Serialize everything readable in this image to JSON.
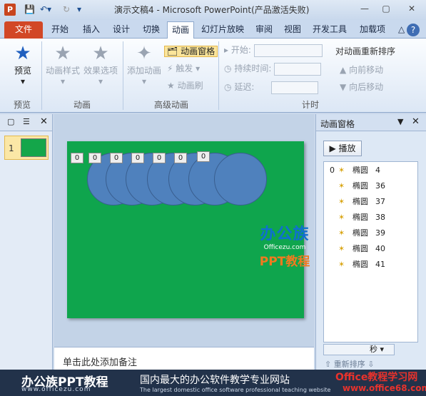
{
  "window": {
    "title": "演示文稿4 - Microsoft PowerPoint(产品激活失败)",
    "app_icon_letter": "P",
    "controls": [
      "—",
      "▢",
      "✕"
    ]
  },
  "tabs": {
    "file": "文件",
    "items": [
      "开始",
      "插入",
      "设计",
      "切换",
      "动画",
      "幻灯片放映",
      "审阅",
      "视图",
      "开发工具",
      "加载项"
    ],
    "active": "动画"
  },
  "ribbon": {
    "preview_btn": "预览",
    "preview_group": "预览",
    "anim_style": "动画样式",
    "effect_options": "效果选项",
    "anim_group": "动画",
    "add_anim": "添加动画",
    "anim_pane_btn": "动画窗格",
    "trigger": "触发 ▾",
    "anim_painter": "动画刷",
    "adv_group": "高级动画",
    "start_label": "开始:",
    "duration_label": "持续时间:",
    "delay_label": "延迟:",
    "reorder_title": "对动画重新排序",
    "move_earlier": "向前移动",
    "move_later": "向后移动",
    "timing_group": "计时"
  },
  "thumbnails": {
    "slide_number": "1"
  },
  "slide": {
    "tags": [
      "0",
      "0",
      "0",
      "0",
      "0",
      "0",
      "0"
    ],
    "watermark": {
      "brand": "办公族",
      "url": "Officezu.com",
      "sub": "PPT教程"
    }
  },
  "notes": {
    "placeholder": "单击此处添加备注"
  },
  "anim_pane": {
    "title": "动画窗格",
    "play_label": "播放",
    "items": [
      {
        "index": "0",
        "name": "椭圆",
        "num": "4"
      },
      {
        "index": "",
        "name": "椭圆",
        "num": "36"
      },
      {
        "index": "",
        "name": "椭圆",
        "num": "37"
      },
      {
        "index": "",
        "name": "椭圆",
        "num": "38"
      },
      {
        "index": "",
        "name": "椭圆",
        "num": "39"
      },
      {
        "index": "",
        "name": "椭圆",
        "num": "40"
      },
      {
        "index": "",
        "name": "椭圆",
        "num": "41"
      }
    ],
    "seconds_label": "秒",
    "reorder_label": "重新排序"
  },
  "banner": {
    "brand": "办公族PPT教程",
    "url": "www.officezu.com",
    "slogan": "国内最大的办公软件教学专业网站",
    "sub": "The largest domestic office software professional teaching website",
    "site2": "Office教程学习网",
    "site2_url": "www.office68.com"
  }
}
